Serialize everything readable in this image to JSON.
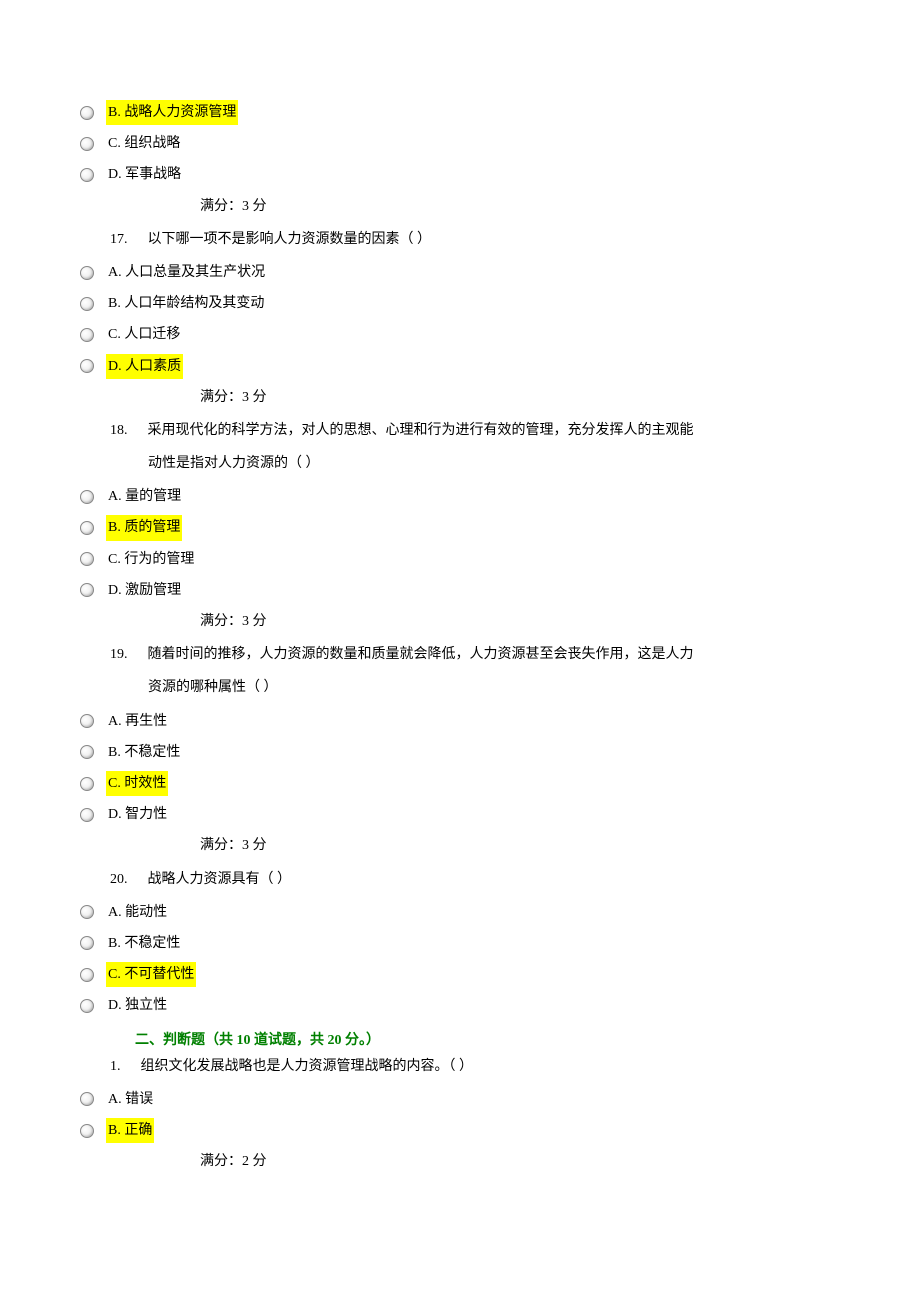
{
  "options_top": [
    {
      "label": "B. 战略人力资源管理",
      "highlight": true
    },
    {
      "label": "C. 组织战略",
      "highlight": false
    },
    {
      "label": "D. 军事战略",
      "highlight": false
    }
  ],
  "score3": "满分：3      分",
  "q17": {
    "num": "17.",
    "text": "以下哪一项不是影响人力资源数量的因素（    ）",
    "options": [
      {
        "label": "A. 人口总量及其生产状况",
        "highlight": false
      },
      {
        "label": "B. 人口年龄结构及其变动",
        "highlight": false
      },
      {
        "label": "C. 人口迁移",
        "highlight": false
      },
      {
        "label": "D. 人口素质",
        "highlight": true
      }
    ]
  },
  "q18": {
    "num": "18.",
    "text": "采用现代化的科学方法，对人的思想、心理和行为进行有效的管理，充分发挥人的主观能",
    "text2": "动性是指对人力资源的（    ）",
    "options": [
      {
        "label": "A. 量的管理",
        "highlight": false
      },
      {
        "label": "B. 质的管理",
        "highlight": true
      },
      {
        "label": "C. 行为的管理",
        "highlight": false
      },
      {
        "label": "D. 激励管理",
        "highlight": false
      }
    ]
  },
  "q19": {
    "num": "19.",
    "text": "随着时间的推移，人力资源的数量和质量就会降低，人力资源甚至会丧失作用，这是人力",
    "text2": "资源的哪种属性（    ）",
    "options": [
      {
        "label": "A. 再生性",
        "highlight": false
      },
      {
        "label": "B. 不稳定性",
        "highlight": false
      },
      {
        "label": "C. 时效性",
        "highlight": true
      },
      {
        "label": "D. 智力性",
        "highlight": false
      }
    ]
  },
  "q20": {
    "num": "20.",
    "text": "战略人力资源具有（    ）",
    "options": [
      {
        "label": "A. 能动性",
        "highlight": false
      },
      {
        "label": "B. 不稳定性",
        "highlight": false
      },
      {
        "label": "C. 不可替代性",
        "highlight": true
      },
      {
        "label": "D. 独立性",
        "highlight": false
      }
    ]
  },
  "section2": "二、判断题（共   10   道试题，共   20   分。）",
  "j1": {
    "num": "1.",
    "text": "组织文化发展战略也是人力资源管理战略的内容。（    ）",
    "options": [
      {
        "label": "A. 错误",
        "highlight": false
      },
      {
        "label": "B. 正确",
        "highlight": true
      }
    ]
  },
  "score2": "满分：2      分"
}
